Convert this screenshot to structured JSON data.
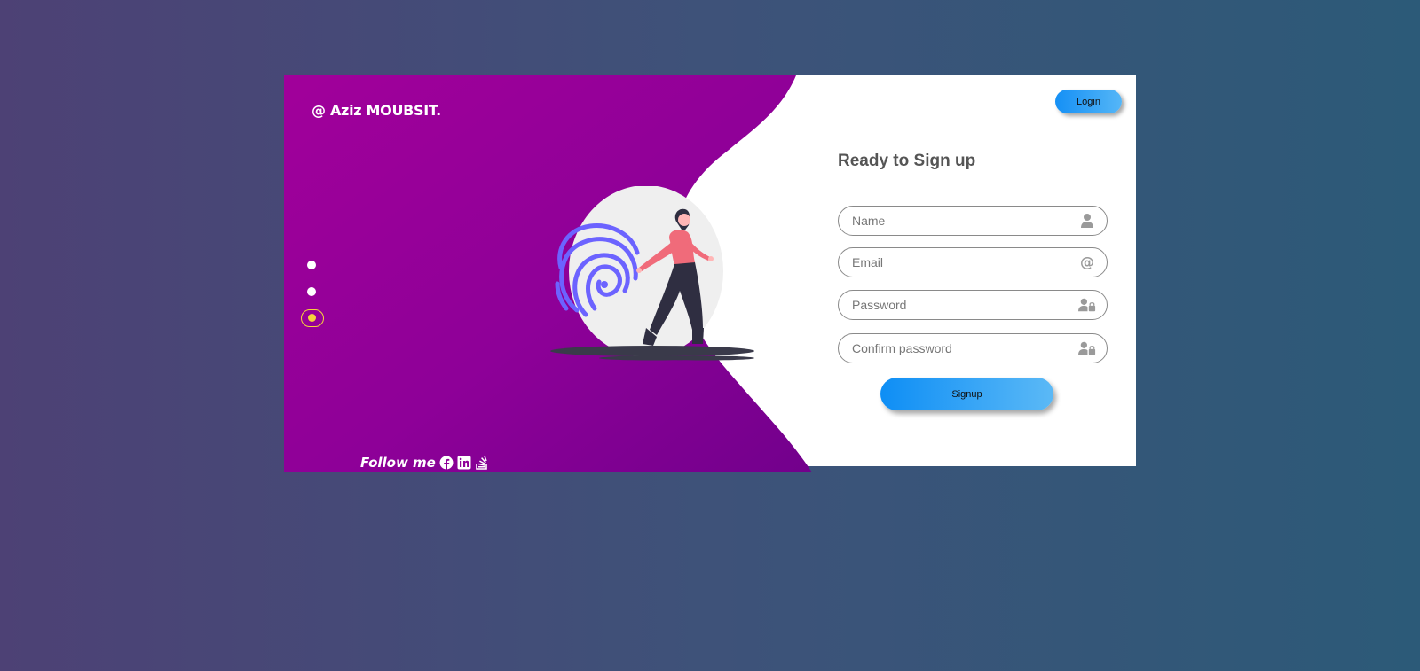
{
  "brand": {
    "text": "@ Aziz MOUBSIT."
  },
  "carousel": {
    "dots": 3,
    "active_index": 2,
    "active_color": "#f5d33b"
  },
  "follow": {
    "label": "Follow me",
    "icons": [
      "facebook-icon",
      "linkedin-icon",
      "stackoverflow-icon"
    ]
  },
  "header": {
    "login_label": "Login"
  },
  "form": {
    "title": "Ready to Sign up",
    "fields": [
      {
        "placeholder": "Name",
        "icon": "user-icon"
      },
      {
        "placeholder": "Email",
        "icon": "at-icon"
      },
      {
        "placeholder": "Password",
        "icon": "user-lock-icon"
      },
      {
        "placeholder": "Confirm password",
        "icon": "user-lock-icon"
      }
    ],
    "submit_label": "Signup"
  },
  "colors": {
    "purple_primary": "#9a0099",
    "purple_dark": "#7a008e",
    "button_blue": "#1590f5",
    "active_dot": "#f5d33b"
  }
}
